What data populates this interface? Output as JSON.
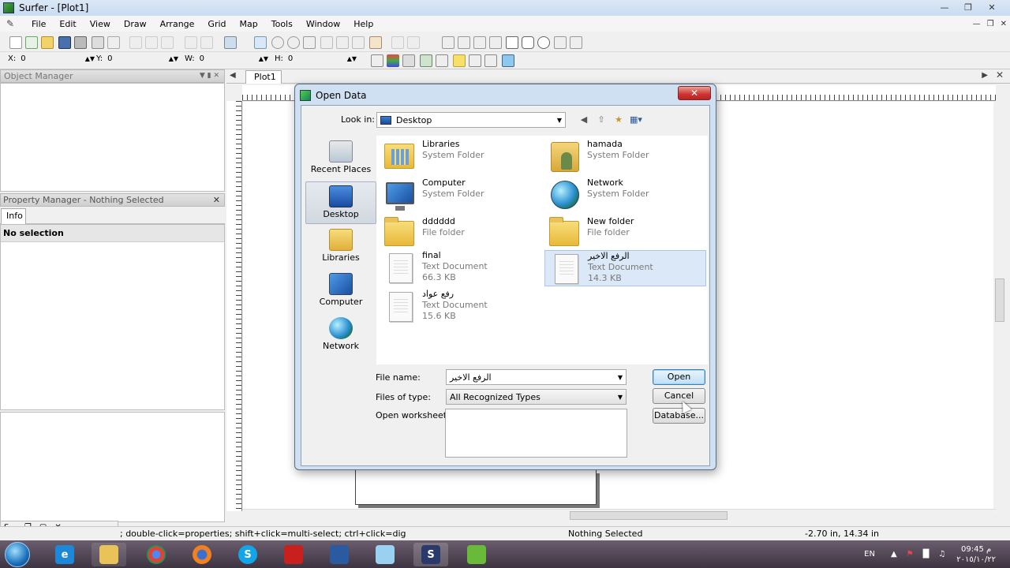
{
  "window": {
    "title": "Surfer - [Plot1]"
  },
  "menu": {
    "items": [
      "File",
      "Edit",
      "View",
      "Draw",
      "Arrange",
      "Grid",
      "Map",
      "Tools",
      "Window",
      "Help"
    ]
  },
  "coords": {
    "x_label": "X:",
    "x_value": "0",
    "y_label": "Y:",
    "y_value": "0",
    "w_label": "W:",
    "w_value": "0",
    "h_label": "H:",
    "h_value": "0"
  },
  "object_manager": {
    "title": "Object Manager"
  },
  "property_manager": {
    "title": "Property Manager - Nothing Selected",
    "tab": "Info",
    "row": "No selection"
  },
  "plot": {
    "tab": "Plot1"
  },
  "dialog": {
    "title": "Open Data",
    "lookin_label": "Look in:",
    "lookin_value": "Desktop",
    "places": [
      "Recent Places",
      "Desktop",
      "Libraries",
      "Computer",
      "Network"
    ],
    "files": [
      {
        "name": "Libraries",
        "type": "System Folder",
        "size": "",
        "icon": "libraries-icon"
      },
      {
        "name": "hamada",
        "type": "System Folder",
        "size": "",
        "icon": "user-folder-icon"
      },
      {
        "name": "Computer",
        "type": "System Folder",
        "size": "",
        "icon": "computer-icon"
      },
      {
        "name": "Network",
        "type": "System Folder",
        "size": "",
        "icon": "network-icon"
      },
      {
        "name": "dddddd",
        "type": "File folder",
        "size": "",
        "icon": "folder-icon"
      },
      {
        "name": "New folder",
        "type": "File folder",
        "size": "",
        "icon": "folder-icon"
      },
      {
        "name": "final",
        "type": "Text Document",
        "size": "66.3 KB",
        "icon": "text-document-icon"
      },
      {
        "name": "الرفع الاخير",
        "type": "Text Document",
        "size": "14.3 KB",
        "icon": "text-document-icon"
      },
      {
        "name": "رفع عواد",
        "type": "Text Document",
        "size": "15.6 KB",
        "icon": "text-document-icon"
      }
    ],
    "file_name_label": "File name:",
    "file_name_value": "الرفع الاخير",
    "file_type_label": "Files of type:",
    "file_type_value": "All Recognized Types",
    "worksheets_label": "Open worksheets:",
    "open_button": "Open",
    "cancel_button": "Cancel",
    "database_button": "Database..."
  },
  "status": {
    "hint": "; double-click=properties; shift+click=multi-select; ctrl+click=dig",
    "selection": "Nothing Selected",
    "position": "-2.70 in, 14.34 in",
    "mini_label": "S..."
  },
  "taskbar": {
    "lang": "EN",
    "time": "09:45 م",
    "date": "٢٠١٥/١٠/٢٢"
  }
}
